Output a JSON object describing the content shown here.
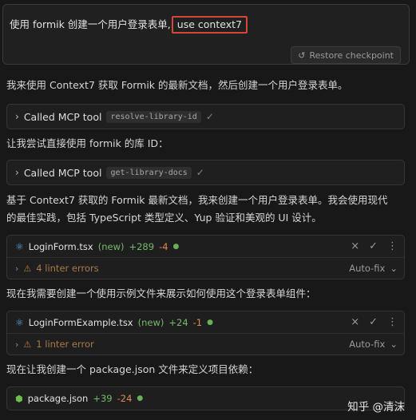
{
  "prompt": {
    "text": "使用 formik 创建一个用户登录表单,",
    "highlight": "use context7",
    "restore_label": "Restore checkpoint"
  },
  "para1": "我来使用 Context7 获取 Formik 的最新文档，然后创建一个用户登录表单。",
  "tool1": {
    "label": "Called MCP tool",
    "tag": "resolve-library-id"
  },
  "para2": "让我尝试直接使用 formik 的库 ID：",
  "tool2": {
    "label": "Called MCP tool",
    "tag": "get-library-docs"
  },
  "para3_line1": "基于 Context7 获取的 Formik 最新文档，我来创建一个用户登录表单。我会使用现代",
  "para3_line2": "的最佳实践，包括 TypeScript 类型定义、Yup 验证和美观的 UI 设计。",
  "file1": {
    "name": "LoginForm.tsx",
    "status": "(new)",
    "added": "+289",
    "removed": "-4",
    "lint": "4 linter errors",
    "autofix": "Auto-fix"
  },
  "para4": "现在我需要创建一个使用示例文件来展示如何使用这个登录表单组件：",
  "file2": {
    "name": "LoginFormExample.tsx",
    "status": "(new)",
    "added": "+24",
    "removed": "-1",
    "lint": "1 linter error",
    "autofix": "Auto-fix"
  },
  "para5": "现在让我创建一个 package.json 文件来定义项目依赖：",
  "file3": {
    "name": "package.json",
    "added": "+39",
    "removed": "-24"
  },
  "watermark": "知乎 @清沫",
  "icons": {
    "restore": "restore-icon",
    "chevron": "chevron-right-icon",
    "check": "check-icon",
    "react": "react-icon",
    "node": "node-icon",
    "warning": "warning-icon",
    "close": "close-icon",
    "more": "more-icon"
  },
  "colors": {
    "highlight_border": "#d8453a",
    "added": "#74b96a",
    "removed": "#e0884e"
  }
}
